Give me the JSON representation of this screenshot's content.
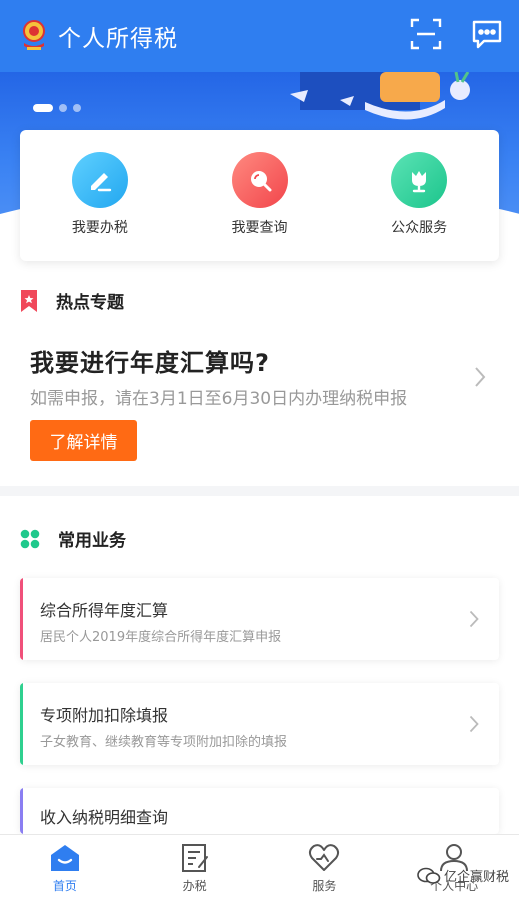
{
  "header": {
    "title": "个人所得税",
    "scan_icon": "scan-icon",
    "message_icon": "message-icon"
  },
  "banner": {
    "slides": 3,
    "active_slide": 1
  },
  "quick_actions": [
    {
      "label": "我要办税",
      "icon": "edit-icon",
      "color": "#22a7f0"
    },
    {
      "label": "我要查询",
      "icon": "search-icon",
      "color": "#f2454b"
    },
    {
      "label": "公众服务",
      "icon": "tulip-icon",
      "color": "#1cc58c"
    }
  ],
  "hot_topics": {
    "title": "热点专题",
    "headline": "我要进行年度汇算吗?",
    "subtitle": "如需申报，请在3月1日至6月30日内办理纳税申报",
    "button": "了解详情"
  },
  "common_services": {
    "title": "常用业务",
    "items": [
      {
        "title": "综合所得年度汇算",
        "subtitle": "居民个人2019年度综合所得年度汇算申报",
        "accent": "#f0507a"
      },
      {
        "title": "专项附加扣除填报",
        "subtitle": "子女教育、继续教育等专项附加扣除的填报",
        "accent": "#2fd08f"
      },
      {
        "title": "收入纳税明细查询",
        "subtitle": "",
        "accent": "#8a7ef2"
      }
    ]
  },
  "bottom_nav": [
    {
      "label": "首页",
      "icon": "home-icon",
      "active": true
    },
    {
      "label": "办税",
      "icon": "form-icon",
      "active": false
    },
    {
      "label": "服务",
      "icon": "heart-icon",
      "active": false
    },
    {
      "label": "个人中心",
      "icon": "person-icon",
      "active": false
    }
  ],
  "watermark": "亿企赢财税",
  "colors": {
    "primary": "#2f7ef0",
    "accent_orange": "#ff6a14"
  }
}
